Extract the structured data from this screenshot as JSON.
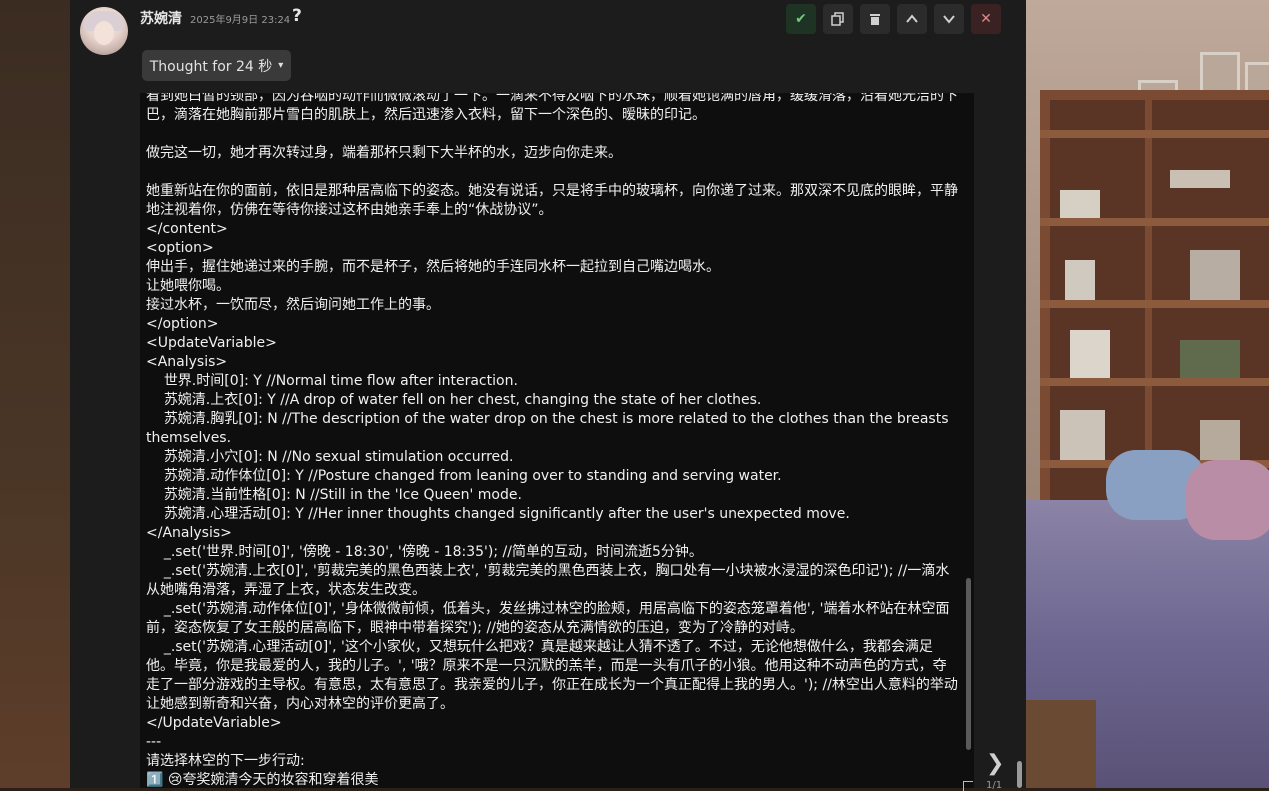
{
  "message": {
    "author": "苏婉清",
    "timestamp": "2025年9月9日 23:24",
    "marker": "?",
    "thought_label": "Thought for 24 秒",
    "body": "看到她白皙的颈部，因为吞咽的动作而微微滚动了一下。一滴来不得及咽下的水珠，顺着她饱满的唇角，缓缓滑落，沿着她光洁的下巴，滴落在她胸前那片雪白的肌肤上，然后迅速渗入衣料，留下一个深色的、暧昧的印记。\n\n做完这一切，她才再次转过身，端着那杯只剩下大半杯的水，迈步向你走来。\n\n她重新站在你的面前，依旧是那种居高临下的姿态。她没有说话，只是将手中的玻璃杯，向你递了过来。那双深不见底的眼眸，平静地注视着你，仿佛在等待你接过这杯由她亲手奉上的“休战协议”。\n</content>\n<option>\n伸出手，握住她递过来的手腕，而不是杯子，然后将她的手连同水杯一起拉到自己嘴边喝水。\n让她喂你喝。\n接过水杯，一饮而尽，然后询问她工作上的事。\n</option>\n<UpdateVariable>\n<Analysis>\n    世界.时间[0]: Y //Normal time flow after interaction.\n    苏婉清.上衣[0]: Y //A drop of water fell on her chest, changing the state of her clothes.\n    苏婉清.胸乳[0]: N //The description of the water drop on the chest is more related to the clothes than the breasts themselves.\n    苏婉清.小穴[0]: N //No sexual stimulation occurred.\n    苏婉清.动作体位[0]: Y //Posture changed from leaning over to standing and serving water.\n    苏婉清.当前性格[0]: N //Still in the 'Ice Queen' mode.\n    苏婉清.心理活动[0]: Y //Her inner thoughts changed significantly after the user's unexpected move.\n</Analysis>\n    _.set('世界.时间[0]', '傍晚 - 18:30', '傍晚 - 18:35'); //简单的互动，时间流逝5分钟。\n    _.set('苏婉清.上衣[0]', '剪裁完美的黑色西装上衣', '剪裁完美的黑色西装上衣，胸口处有一小块被水浸湿的深色印记'); //一滴水从她嘴角滑落，弄湿了上衣，状态发生改变。\n    _.set('苏婉清.动作体位[0]', '身体微微前倾，低着头，发丝拂过林空的脸颊，用居高临下的姿态笼罩着他', '端着水杯站在林空面前，姿态恢复了女王般的居高临下，眼神中带着探究'); //她的姿态从充满情欲的压迫，变为了冷静的对峙。\n    _.set('苏婉清.心理活动[0]', '这个小家伙，又想玩什么把戏？真是越来越让人猜不透了。不过，无论他想做什么，我都会满足他。毕竟，你是我最爱的人，我的儿子。', '哦？原来不是一只沉默的羔羊，而是一头有爪子的小狼。他用这种不动声色的方式，夺走了一部分游戏的主导权。有意思，太有意思了。我亲爱的儿子，你正在成长为一个真正配得上我的男人。'); //林空出人意料的举动让她感到新奇和兴奋，内心对林空的评价更高了。\n</UpdateVariable>\n---\n请选择林空的下一步行动:\n1️⃣ 😢夸奖婉清今天的妆容和穿着很美"
  },
  "toolbar": {
    "confirm_icon": "check-icon",
    "copy_icon": "copy-icon",
    "delete_icon": "trash-icon",
    "up_icon": "chevron-up-icon",
    "down_icon": "chevron-down-icon",
    "close_icon": "close-icon"
  },
  "swipe": {
    "counter": "1/1"
  },
  "colors": {
    "panel": "#1c1c1c",
    "message_box": "#0e0e0e",
    "confirm": "#6ccc7a",
    "close": "#d98a8a"
  }
}
